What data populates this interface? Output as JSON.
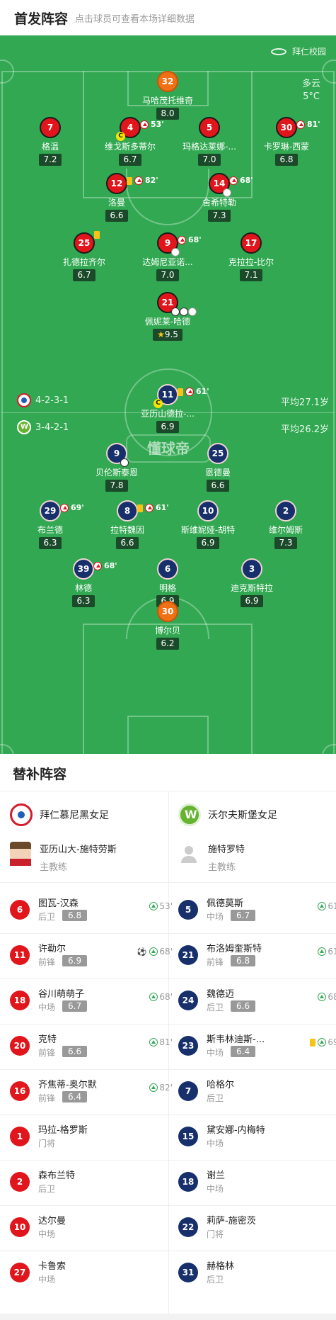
{
  "header": {
    "title": "首发阵容",
    "subtitle": "点击球员可查看本场详细数据"
  },
  "pitch": {
    "venue": "拜仁校园",
    "weather": "多云",
    "temperature": "5°C",
    "watermark": "懂球帝",
    "home": {
      "formation": "4-2-3-1",
      "avg_age": "平均27.1岁"
    },
    "away": {
      "formation": "3-4-2-1",
      "avg_age": "平均26.2岁"
    }
  },
  "home_players": [
    {
      "num": "32",
      "name": "马哈茂托维奇",
      "rating": "8.0",
      "color": "org"
    },
    {
      "num": "7",
      "name": "格温",
      "rating": "7.2",
      "color": "red"
    },
    {
      "num": "4",
      "name": "维戈斯多蒂尔",
      "rating": "6.7",
      "color": "red",
      "sub": "53'",
      "captain": "C"
    },
    {
      "num": "5",
      "name": "玛格达莱娜-...",
      "rating": "7.0",
      "color": "red"
    },
    {
      "num": "30",
      "name": "卡罗琳-西蒙",
      "rating": "6.8",
      "color": "red",
      "sub": "81'"
    },
    {
      "num": "12",
      "name": "洛曼",
      "rating": "6.6",
      "color": "red",
      "sub": "82'",
      "yellow": true
    },
    {
      "num": "14",
      "name": "舍希特勒",
      "rating": "7.3",
      "color": "red",
      "sub": "68'",
      "boot": true
    },
    {
      "num": "25",
      "name": "扎德拉齐尔",
      "rating": "6.7",
      "color": "red",
      "yellow": true
    },
    {
      "num": "9",
      "name": "达姆尼亚诺...",
      "rating": "7.0",
      "color": "red",
      "sub": "68'",
      "boot": true
    },
    {
      "num": "17",
      "name": "克拉拉-比尔",
      "rating": "7.1",
      "color": "red"
    },
    {
      "num": "21",
      "name": "佩妮莱-哈德",
      "rating": "9.5",
      "color": "red",
      "goals": 2,
      "boot": true,
      "mvp": true
    }
  ],
  "away_players": [
    {
      "num": "11",
      "name": "亚历山德拉-...",
      "rating": "6.9",
      "sub": "61'",
      "yellow": true,
      "captain": "C"
    },
    {
      "num": "9",
      "name": "贝伦斯泰恩",
      "rating": "7.8",
      "goals": 1
    },
    {
      "num": "25",
      "name": "恩德曼",
      "rating": "6.6"
    },
    {
      "num": "29",
      "name": "布兰德",
      "rating": "6.3",
      "sub": "69'"
    },
    {
      "num": "8",
      "name": "拉特魏因",
      "rating": "6.6",
      "sub": "61'",
      "yellow": true
    },
    {
      "num": "10",
      "name": "斯维妮娅-胡特",
      "rating": "6.9"
    },
    {
      "num": "2",
      "name": "维尔姆斯",
      "rating": "7.3"
    },
    {
      "num": "39",
      "name": "林德",
      "rating": "6.3",
      "sub": "68'"
    },
    {
      "num": "6",
      "name": "明格",
      "rating": "6.9"
    },
    {
      "num": "3",
      "name": "迪克斯特拉",
      "rating": "6.9"
    },
    {
      "num": "30",
      "name": "博尔贝",
      "rating": "6.2",
      "color": "org"
    }
  ],
  "subs": {
    "title": "替补阵容",
    "home_team": "拜仁慕尼黑女足",
    "away_team": "沃尔夫斯堡女足",
    "home_coach": {
      "name": "亚历山大-施特劳斯",
      "role": "主教练"
    },
    "away_coach": {
      "name": "施特罗特",
      "role": "主教练"
    },
    "home": [
      {
        "num": "6",
        "name": "图瓦-汉森",
        "pos": "后卫",
        "rating": "6.8",
        "in": "53'"
      },
      {
        "num": "11",
        "name": "许勒尔",
        "pos": "前锋",
        "rating": "6.9",
        "in": "68'",
        "goal": true
      },
      {
        "num": "18",
        "name": "谷川萌萌子",
        "pos": "中场",
        "rating": "6.7",
        "in": "68'"
      },
      {
        "num": "20",
        "name": "克特",
        "pos": "前锋",
        "rating": "6.6",
        "in": "81'"
      },
      {
        "num": "16",
        "name": "齐焦蒂-奥尔默",
        "pos": "前锋",
        "rating": "6.4",
        "in": "82'"
      },
      {
        "num": "1",
        "name": "玛拉-格罗斯",
        "pos": "门将"
      },
      {
        "num": "2",
        "name": "森布兰特",
        "pos": "后卫"
      },
      {
        "num": "10",
        "name": "达尔曼",
        "pos": "中场"
      },
      {
        "num": "27",
        "name": "卡鲁索",
        "pos": "中场"
      }
    ],
    "away": [
      {
        "num": "5",
        "name": "佩德莫斯",
        "pos": "中场",
        "rating": "6.7",
        "in": "61'"
      },
      {
        "num": "21",
        "name": "布洛姆奎斯特",
        "pos": "前锋",
        "rating": "6.8",
        "in": "61'"
      },
      {
        "num": "24",
        "name": "魏德迈",
        "pos": "后卫",
        "rating": "6.6",
        "in": "68'"
      },
      {
        "num": "23",
        "name": "斯韦林迪斯-...",
        "pos": "中场",
        "rating": "6.4",
        "in": "69'",
        "yellow": true
      },
      {
        "num": "7",
        "name": "哈格尔",
        "pos": "后卫"
      },
      {
        "num": "15",
        "name": "黛安娜-内梅特",
        "pos": "中场"
      },
      {
        "num": "18",
        "name": "谢兰",
        "pos": "中场"
      },
      {
        "num": "22",
        "name": "莉萨-施密茨",
        "pos": "门将"
      },
      {
        "num": "31",
        "name": "赫格林",
        "pos": "后卫"
      }
    ]
  }
}
